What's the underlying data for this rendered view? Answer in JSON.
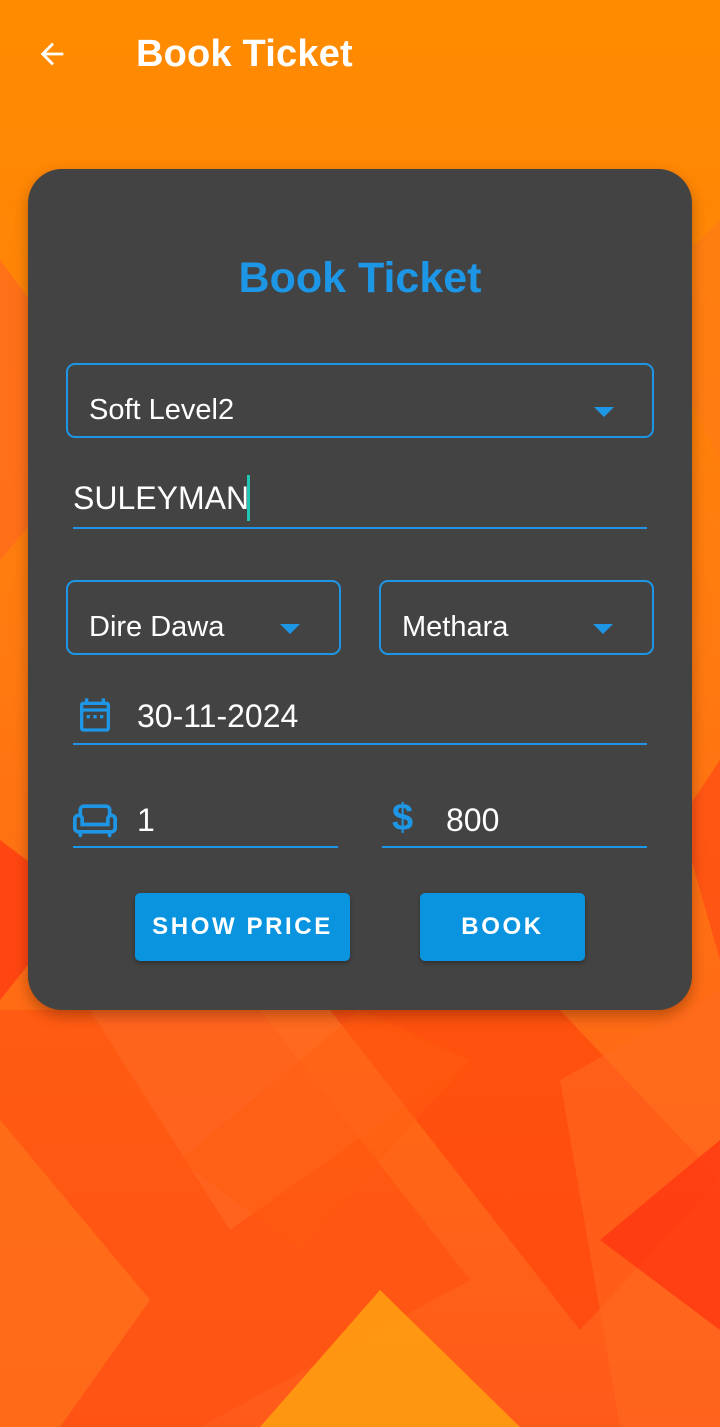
{
  "appbar": {
    "title": "Book Ticket",
    "back_icon": "arrow-back-icon"
  },
  "form": {
    "title": "Book Ticket",
    "bus_level": {
      "value": "Soft Level2",
      "icon": "dropdown-arrow-icon"
    },
    "passenger_name": {
      "value": "SULEYMAN"
    },
    "from_city": {
      "value": "Dire Dawa",
      "icon": "dropdown-arrow-icon"
    },
    "to_city": {
      "value": "Methara",
      "icon": "dropdown-arrow-icon"
    },
    "travel_date": {
      "value": "30-11-2024",
      "icon": "calendar-icon"
    },
    "seats": {
      "value": "1",
      "icon": "seat-icon"
    },
    "price": {
      "value": "800",
      "icon": "dollar-icon"
    },
    "show_price_label": "SHOW PRICE",
    "book_label": "BOOK"
  },
  "colors": {
    "accent": "#1e96e6",
    "button": "#0a94e0",
    "card": "#434343",
    "background": "#ff8a00",
    "cursor": "#1ec8b4"
  }
}
